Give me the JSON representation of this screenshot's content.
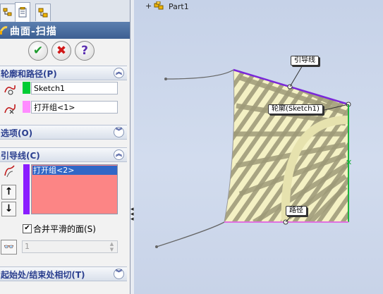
{
  "feature": {
    "title": "曲面-扫描",
    "ok_label": "✔",
    "cancel_label": "✖",
    "help_label": "?"
  },
  "sections": {
    "profile_path": {
      "header": "轮廓和路径(P)",
      "profile_value": "Sketch1",
      "path_value": "打开组<1>",
      "profile_color": "#00cc33",
      "path_color": "#ff8cff"
    },
    "options": {
      "header": "选项(O)"
    },
    "guide_curves": {
      "header": "引导线(C)",
      "items": [
        "打开组<2>"
      ],
      "up_label": "↑",
      "down_label": "↓",
      "merge_smooth_label": "合并平滑的面(S)",
      "merge_smooth_checked": true,
      "guide_color": "#8a1cff",
      "list_color": "#fc8585",
      "section_count": "1"
    },
    "tangency": {
      "header": "起始处/结束处相切(T)"
    }
  },
  "viewport": {
    "tree_expander": "+",
    "part_name": "Part1",
    "callouts": {
      "guide": "引导线",
      "profile": "轮廓(Sketch1)",
      "path": "路径"
    },
    "colors": {
      "guide_line": "#7a28d8",
      "path_line": "#e070e0",
      "edge_line": "#19b23a"
    }
  }
}
